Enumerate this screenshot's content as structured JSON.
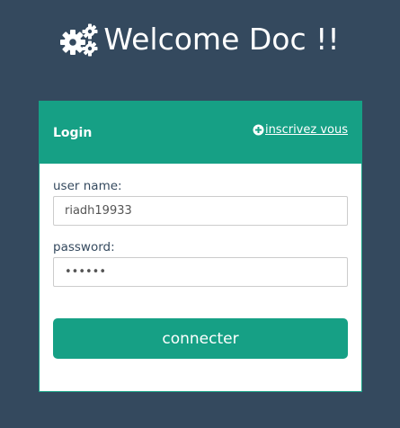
{
  "header": {
    "title": "Welcome Doc !!",
    "icon": "cogs-icon"
  },
  "login_card": {
    "title": "Login",
    "register_link": {
      "label": "inscrivez vous",
      "icon": "plus-circle-icon"
    },
    "username": {
      "label": "user name:",
      "value": "riadh19933"
    },
    "password": {
      "label": "password:",
      "value": "riadh1"
    },
    "submit_label": "connecter"
  },
  "colors": {
    "background": "#34495e",
    "accent": "#16a085",
    "text_dark": "#34495e",
    "input_border": "#cccccc"
  }
}
